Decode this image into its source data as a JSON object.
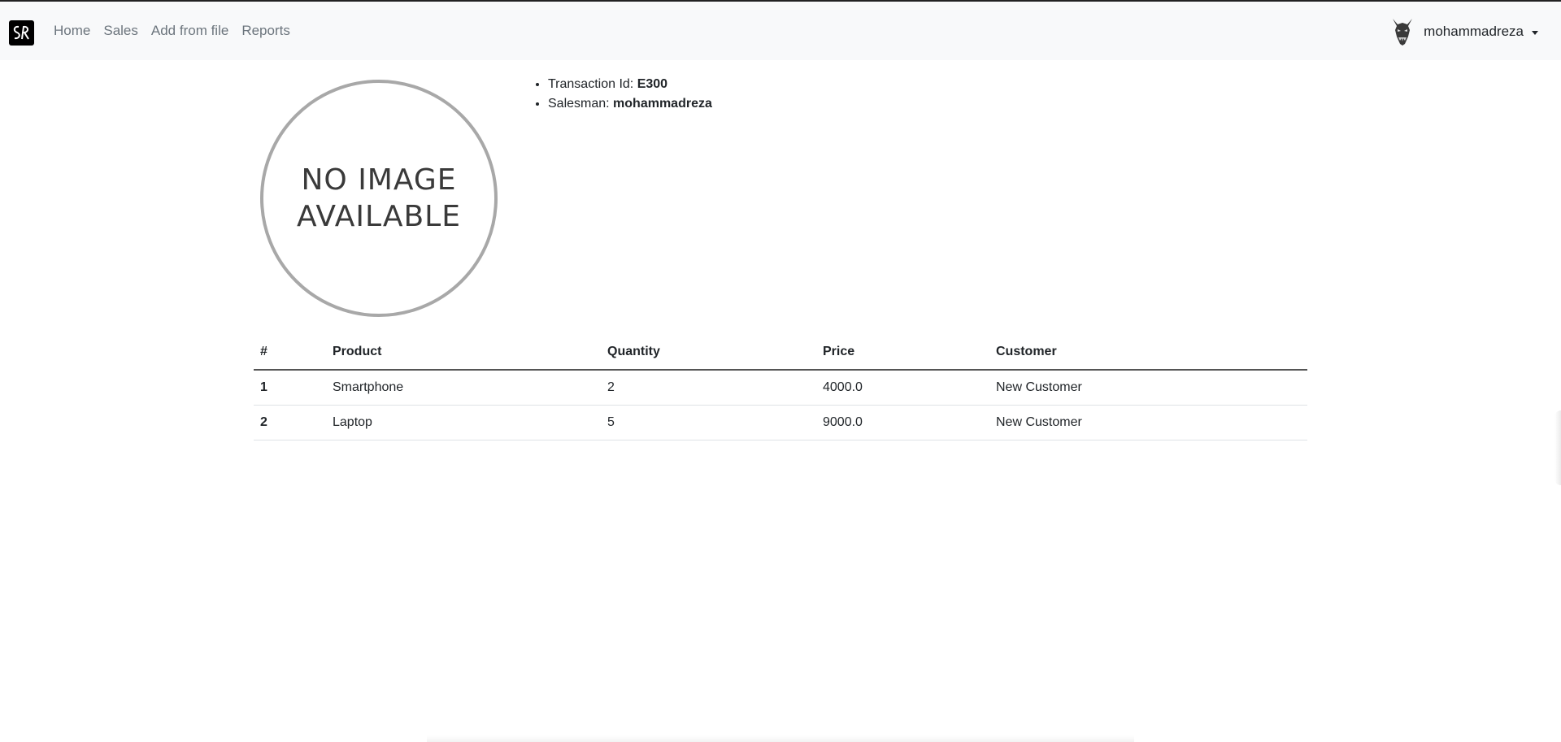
{
  "navbar": {
    "brand_icon": "sr-logo-icon",
    "links": [
      "Home",
      "Sales",
      "Add from file",
      "Reports"
    ],
    "user": {
      "name": "mohammadreza",
      "avatar_icon": "demon-mask-avatar"
    }
  },
  "placeholder_image": {
    "text": "NO IMAGE AVAILABLE"
  },
  "transaction": {
    "id_label": "Transaction Id:",
    "id_value": "E300",
    "salesman_label": "Salesman:",
    "salesman_value": "mohammadreza"
  },
  "table": {
    "headers": [
      "#",
      "Product",
      "Quantity",
      "Price",
      "Customer"
    ],
    "rows": [
      {
        "num": "1",
        "product": "Smartphone",
        "quantity": "2",
        "price": "4000.0",
        "customer": "New Customer"
      },
      {
        "num": "2",
        "product": "Laptop",
        "quantity": "5",
        "price": "9000.0",
        "customer": "New Customer"
      }
    ]
  }
}
